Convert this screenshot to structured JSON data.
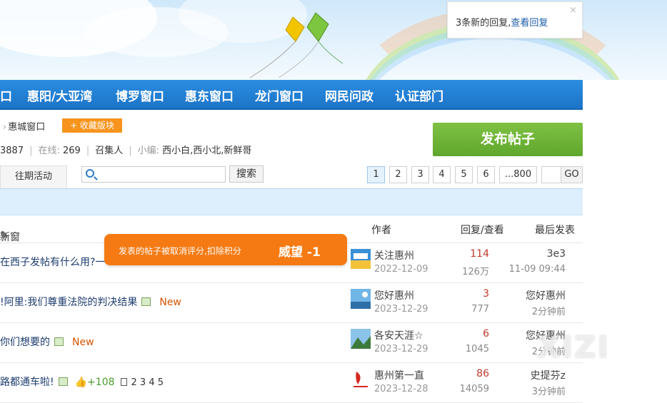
{
  "notification": {
    "text": "3条新的回复,",
    "link": "查看回复",
    "close": "×"
  },
  "nav": {
    "items": [
      "口",
      "惠阳/大亚湾",
      "博罗窗口",
      "惠东窗口",
      "龙门窗口",
      "网民问政",
      "认证部门"
    ]
  },
  "breadcrumb": {
    "current": "惠城窗口",
    "favorite_button": "+ 收藏版块"
  },
  "stats": {
    "today_suffix": "3887",
    "online_label": "在线:",
    "online_value": "269",
    "recruit": "召集人",
    "editor_label": "小编:",
    "editors": "西小白,西小北,新鲜哥"
  },
  "post_button": "发布帖子",
  "tab_label": "往期活动",
  "search": {
    "button": "搜索",
    "placeholder": ""
  },
  "pagination": {
    "pages": [
      "1",
      "2",
      "3",
      "4",
      "5",
      "6",
      "...800"
    ],
    "current": "1",
    "go": "GO"
  },
  "columns": {
    "first": "新窗",
    "author": "作者",
    "replies": "回复/查看",
    "last": "最后发表"
  },
  "toast": {
    "message": "发表的帖子被取消评分,扣除积分",
    "points": "威望 -1"
  },
  "rows": [
    {
      "title": "在西子发帖有什么用?一",
      "author": "关注惠州",
      "date": "2022-12-09",
      "replies": "114",
      "views": "126万",
      "last_user": "3e3",
      "last_time": "11-09 09:44"
    },
    {
      "title": "!阿里:我们尊重法院的判决结果",
      "new": "New",
      "author": "您好惠州",
      "date": "2023-12-29",
      "replies": "3",
      "views": "777",
      "last_user": "您好惠州",
      "last_time": "2分钟前"
    },
    {
      "title": "你们想要的",
      "new": "New",
      "author": "各安天涯☆",
      "date": "2023-12-29",
      "replies": "6",
      "views": "1045",
      "last_user": "您好惠州",
      "last_time": "2分钟前"
    },
    {
      "title": "路都通车啦!",
      "plus": "+108",
      "pages": "2 3 4 5",
      "author": "惠州第一直",
      "date": "2023-12-28",
      "replies": "86",
      "views": "14059",
      "last_user": "史提芬z",
      "last_time": "3分钟前"
    }
  ],
  "watermark": "XIZI",
  "colors": {
    "nav": "#1c74c8",
    "post_button": "#6aaf33",
    "toast": "#f57a13",
    "fav_button": "#f7941d"
  }
}
